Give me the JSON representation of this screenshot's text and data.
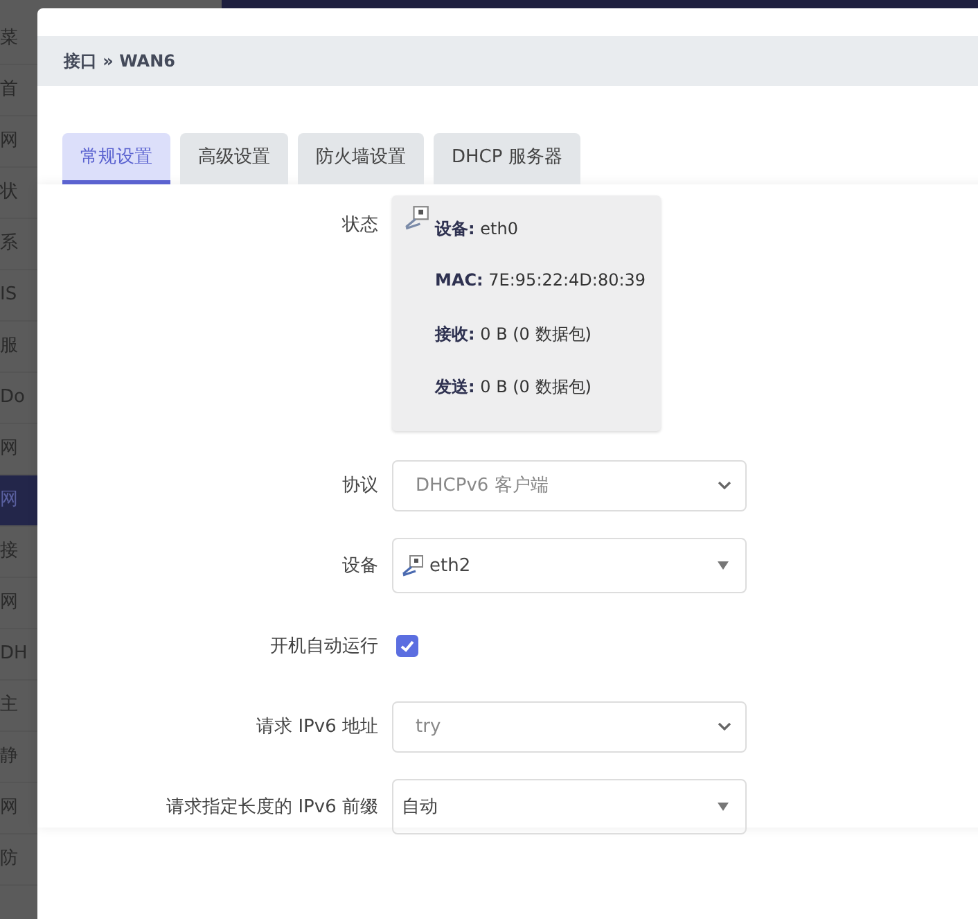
{
  "background_sidebar": {
    "items": [
      {
        "label": "菜",
        "selected": false
      },
      {
        "label": "首",
        "selected": false
      },
      {
        "label": "网",
        "selected": false
      },
      {
        "label": "状",
        "selected": false
      },
      {
        "label": "系",
        "selected": false
      },
      {
        "label": "IS",
        "selected": false
      },
      {
        "label": "服",
        "selected": false
      },
      {
        "label": "Do",
        "selected": false
      },
      {
        "label": "网",
        "selected": false
      },
      {
        "label": "网",
        "selected": true
      },
      {
        "label": "接",
        "selected": false
      },
      {
        "label": "网",
        "selected": false
      },
      {
        "label": "DH",
        "selected": false
      },
      {
        "label": "主",
        "selected": false
      },
      {
        "label": "静",
        "selected": false
      },
      {
        "label": "网",
        "selected": false
      },
      {
        "label": "防",
        "selected": false
      }
    ]
  },
  "breadcrumb": "接口 » WAN6",
  "tabs": [
    {
      "label": "常规设置",
      "selected": true
    },
    {
      "label": "高级设置",
      "selected": false
    },
    {
      "label": "防火墙设置",
      "selected": false
    },
    {
      "label": "DHCP 服务器",
      "selected": false
    }
  ],
  "status": {
    "label": "状态",
    "lines": [
      {
        "key": "设备:",
        "value": "eth0"
      },
      {
        "key": "MAC:",
        "value": "7E:95:22:4D:80:39"
      },
      {
        "key": "接收:",
        "value": "0 B (0 数据包)"
      },
      {
        "key": "发送:",
        "value": "0 B (0 数据包)"
      }
    ]
  },
  "fields": [
    {
      "kind": "select",
      "label": "协议",
      "value": "DHCPv6 客户端",
      "disabled": true
    },
    {
      "kind": "device",
      "label": "设备",
      "value": "eth2",
      "disabled": false
    },
    {
      "kind": "checkbox",
      "label": "开机自动运行",
      "checked": true
    },
    {
      "kind": "select",
      "label": "请求 IPv6 地址",
      "value": "try",
      "disabled": true
    },
    {
      "kind": "dropdown",
      "label": "请求指定长度的 IPv6 前缀",
      "value": "自动",
      "disabled": false
    }
  ]
}
